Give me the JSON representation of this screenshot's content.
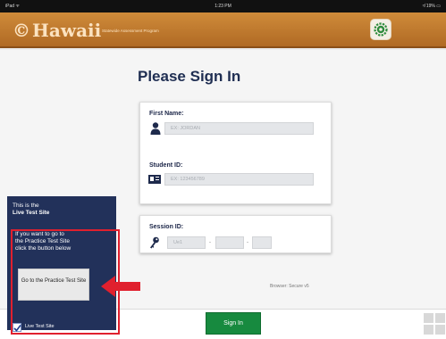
{
  "status_bar": {
    "left": "iPad ᯤ",
    "time": "1:23 PM",
    "right": "≉ 19% ▭"
  },
  "header": {
    "logo_mark": "©",
    "logo_word": "Hawaii",
    "logo_subtitle": "Statewide Assessment Program",
    "settings_icon": "gear-icon",
    "accent_color": "#b06a24"
  },
  "form": {
    "title": "Please Sign In",
    "first_name": {
      "label": "First Name:",
      "placeholder": "EX: JORDAN",
      "icon": "person-icon"
    },
    "student_id": {
      "label": "Student ID:",
      "placeholder": "EX: 123456789",
      "icon": "id-card-icon"
    },
    "session_id": {
      "label": "Session ID:",
      "prefix": "Ue1",
      "separator": "-",
      "icon": "key-icon"
    },
    "browser": "Browser: Secure v5",
    "signin_label": "Sign In",
    "signin_color": "#178a3f"
  },
  "live_panel": {
    "line1": "This is the",
    "line2": "Live Test Site",
    "line3": "If you want to go to",
    "line4": "the Practice Test Site",
    "line5": "click the button below",
    "practice_button": "Go to the Practice Test Site",
    "checkbox_label": "Live Test Site",
    "checked": true,
    "panel_color": "#22315a",
    "highlight_color": "#e0202e"
  }
}
